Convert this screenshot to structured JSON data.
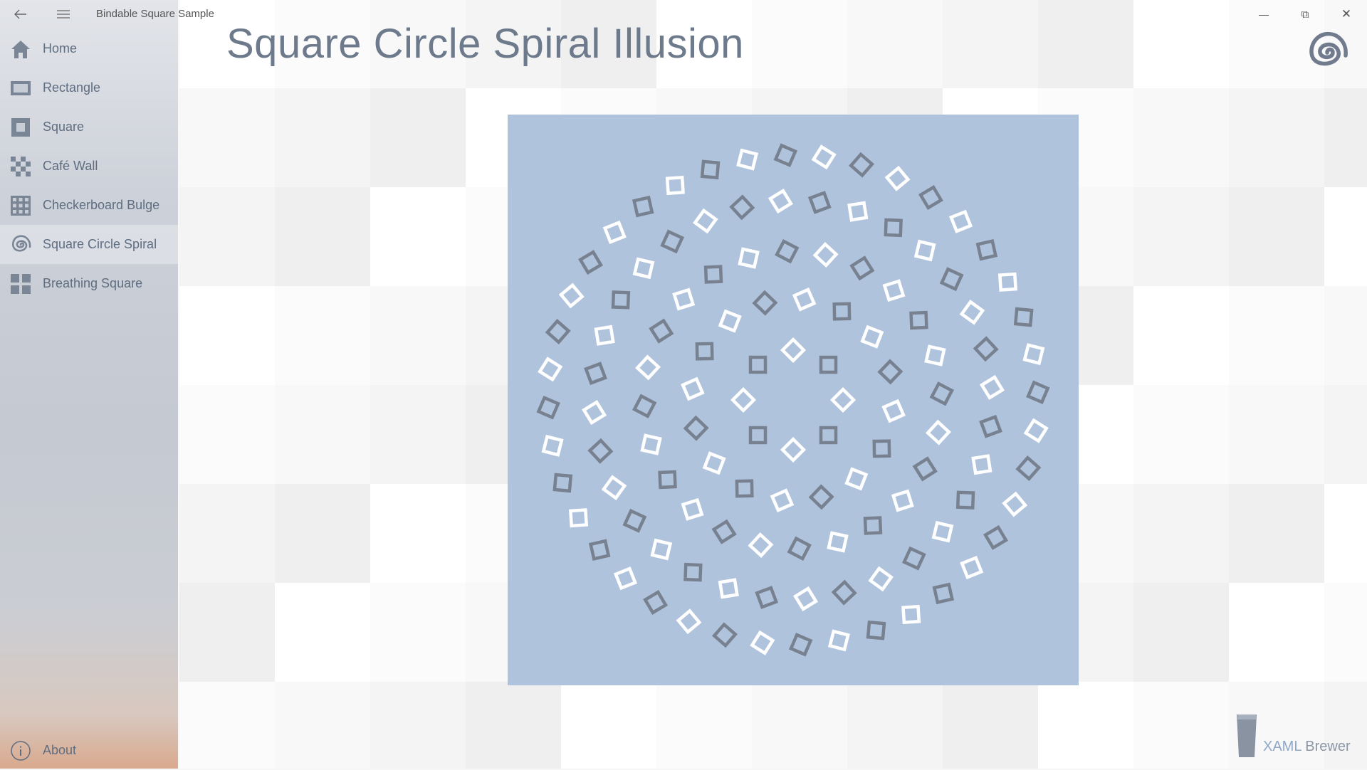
{
  "window": {
    "title": "Bindable Square Sample",
    "back_icon": "back-arrow-icon",
    "hamburger_icon": "hamburger-menu-icon",
    "minimize_glyph": "—",
    "maximize_glyph": "⧉",
    "close_glyph": "✕"
  },
  "sidebar": {
    "items": [
      {
        "label": "Home",
        "icon": "home-icon",
        "selected": false
      },
      {
        "label": "Rectangle",
        "icon": "rectangle-icon",
        "selected": false
      },
      {
        "label": "Square",
        "icon": "square-icon",
        "selected": false
      },
      {
        "label": "Café Wall",
        "icon": "cafe-wall-icon",
        "selected": false
      },
      {
        "label": "Checkerboard Bulge",
        "icon": "checkerboard-bulge-icon",
        "selected": false
      },
      {
        "label": "Square Circle Spiral",
        "icon": "spiral-icon",
        "selected": true
      },
      {
        "label": "Breathing Square",
        "icon": "breathing-square-icon",
        "selected": false
      }
    ],
    "about": {
      "label": "About",
      "icon": "info-icon"
    }
  },
  "main": {
    "title": "Square Circle Spiral Illusion",
    "header_icon": "spiral-icon"
  },
  "illusion": {
    "background_color": "#b0c3dd",
    "light_color": "#ffffff",
    "dark_color": "#77818f",
    "rings": [
      {
        "count": 8,
        "rotation_deg": 45
      },
      {
        "count": 16,
        "rotation_deg": -30
      },
      {
        "count": 24,
        "rotation_deg": 30
      },
      {
        "count": 32,
        "rotation_deg": -28
      },
      {
        "count": 40,
        "rotation_deg": 25
      }
    ]
  },
  "brand": {
    "xaml": "XAML",
    "brewer": " Brewer"
  },
  "colors": {
    "accent_text": "#5f6d80",
    "title_text": "#6d7a8c",
    "icon": "#7a8596"
  }
}
